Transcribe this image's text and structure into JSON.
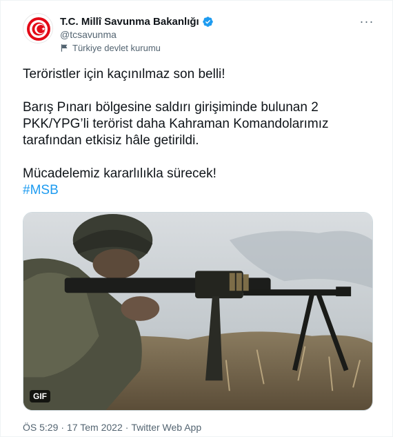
{
  "author": {
    "name": "T.C. Millî Savunma Bakanlığı",
    "handle": "@tcsavunma",
    "label": "Türkiye devlet kurumu",
    "verified_icon": "verified-badge-icon",
    "label_icon": "flag-icon"
  },
  "menu": {
    "more_label": "···"
  },
  "tweet": {
    "line1": "Teröristler için kaçınılmaz son belli!",
    "line2": "Barış Pınarı bölgesine saldırı girişiminde bulunan 2 PKK/YPG’li terörist daha Kahraman Komandolarımız tarafından etkisiz hâle getirildi.",
    "line3": "Mücadelemiz kararlılıkla sürecek!",
    "hashtag": "#MSB"
  },
  "media": {
    "badge": "GIF",
    "alt": "Soldier with machine gun"
  },
  "meta": {
    "time": "ÖS 5:29",
    "sep1": "·",
    "date": "17 Tem 2022",
    "sep2": "·",
    "source": "Twitter Web App"
  },
  "colors": {
    "accent": "#1d9bf0",
    "text": "#0f1419",
    "muted": "#536471",
    "border": "#cfd9de"
  }
}
